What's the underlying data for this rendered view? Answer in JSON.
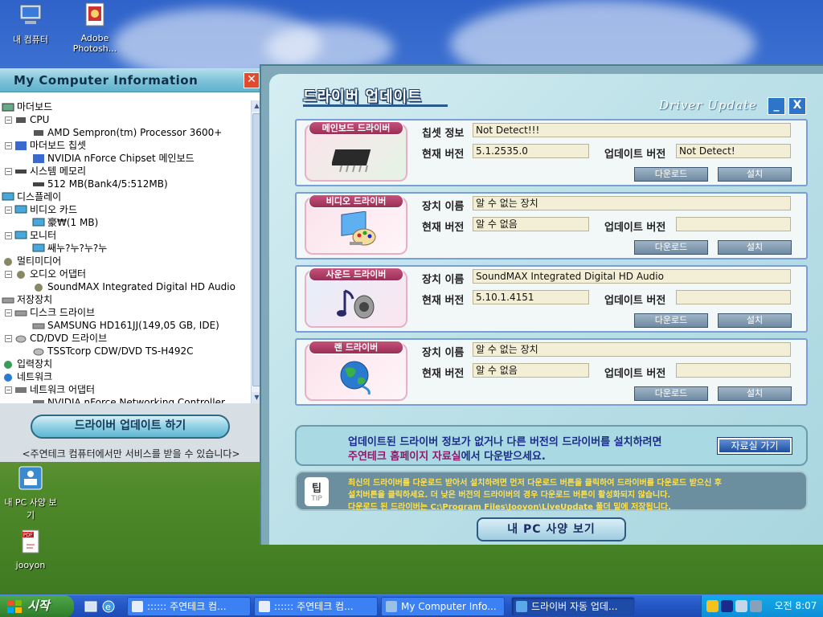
{
  "desktop": {
    "icons": [
      {
        "label": "내 컴퓨터"
      },
      {
        "label": "Adobe Photosh..."
      },
      {
        "label": "내 PC 사양 보기"
      },
      {
        "label": "jooyon"
      }
    ]
  },
  "info_window": {
    "title": "My Computer Information",
    "close": "✕",
    "tree": [
      {
        "text": "마더보드"
      },
      {
        "text": "CPU"
      },
      {
        "text": "AMD Sempron(tm) Processor 3600+"
      },
      {
        "text": "마더보드 칩셋"
      },
      {
        "text": "NVIDIA nForce Chipset 메인보드"
      },
      {
        "text": "시스템 메모리"
      },
      {
        "text": "512 MB(Bank4/5:512MB)"
      },
      {
        "text": "디스플레이"
      },
      {
        "text": "비디오 카드"
      },
      {
        "text": "豪₩(1 MB)"
      },
      {
        "text": "모니터"
      },
      {
        "text": "쌔누?누?누?누"
      },
      {
        "text": "멀티미디어"
      },
      {
        "text": "오디오 어댑터"
      },
      {
        "text": "SoundMAX Integrated Digital HD Audio"
      },
      {
        "text": "저장장치"
      },
      {
        "text": "디스크 드라이브"
      },
      {
        "text": "SAMSUNG HD161JJ(149,05 GB, IDE)"
      },
      {
        "text": "CD/DVD 드라이브"
      },
      {
        "text": "TSSTcorp CDW/DVD TS-H492C"
      },
      {
        "text": "입력장치"
      },
      {
        "text": "네트워크"
      },
      {
        "text": "네트워크 어댑터"
      },
      {
        "text": "NVIDIA nForce Networking Controller"
      }
    ],
    "update_button": "드라이버 업데이트 하기",
    "note": "<주연테크 컴퓨터에서만 서비스를 받을 수 있습니다>"
  },
  "driver_window": {
    "title": "드라이버 업데이트",
    "subtitle": "Driver Update",
    "minimize": "_",
    "close": "X",
    "panels": [
      {
        "tag": "메인보드 드라이버",
        "icon": "chip-icon",
        "label1": "칩셋 정보",
        "value1": "Not Detect!!!",
        "label2": "현재 버전",
        "value2": "5.1.2535.0",
        "label3": "업데이트 버전",
        "value3": "Not Detect!",
        "download": "다운로드",
        "install": "설치"
      },
      {
        "tag": "비디오 드라이버",
        "icon": "monitor-palette-icon",
        "label1": "장치 이름",
        "value1": "알 수 없는 장치",
        "label2": "현재 버전",
        "value2": "알 수 없음",
        "label3": "업데이트 버전",
        "value3": "",
        "download": "다운로드",
        "install": "설치"
      },
      {
        "tag": "사운드 드라이버",
        "icon": "speaker-note-icon",
        "label1": "장치 이름",
        "value1": "SoundMAX Integrated Digital HD Audio",
        "label2": "현재 버전",
        "value2": "5.10.1.4151",
        "label3": "업데이트 버전",
        "value3": "",
        "download": "다운로드",
        "install": "설치"
      },
      {
        "tag": "랜 드라이버",
        "icon": "globe-icon",
        "label1": "장치 이름",
        "value1": "알 수 없는 장치",
        "label2": "현재 버전",
        "value2": "알 수 없음",
        "label3": "업데이트 버전",
        "value3": "",
        "download": "다운로드",
        "install": "설치"
      }
    ],
    "message": {
      "line1": "업데이트된 드라이버 정보가 없거나 다른 버전의 드라이버를 설치하려면",
      "line2_highlight": "주연테크 홈페이지 자료실",
      "line2_rest": "에서 다운받으세요.",
      "button": "자료실 가기"
    },
    "tip": {
      "icon_main": "팁",
      "icon_sub": "TIP",
      "line1": "최신의 드라이버를 다운로드 받아서 설치하려면 먼저 다운로드 버튼을 클릭하여 드라이버를 다운로드 받으신 후",
      "line2": "설치버튼을 클릭하세요. 더 낮은 버전의 드라이버의 경우 다운로드 버튼이 활성화되지 않습니다.",
      "line3": "다운로드 된 드라이버는 C:\\Program Files\\Jooyon\\LiveUpdate 폴더 밑에 저장됩니다."
    },
    "spec_button": "내 PC 사양 보기"
  },
  "taskbar": {
    "start": "시작",
    "tasks": [
      {
        "label": ":::::: 주연테크 컴..."
      },
      {
        "label": ":::::: 주연테크 컴..."
      },
      {
        "label": "My Computer Info..."
      },
      {
        "label": "드라이버 자동 업데..."
      }
    ],
    "clock": "오전 8:07"
  },
  "colors": {
    "accent": "#2456c3",
    "panel_border": "#7a9fd6",
    "tag": "#9a2f56",
    "tip_text": "#ffe24a",
    "message_text": "#1b2c8a"
  }
}
